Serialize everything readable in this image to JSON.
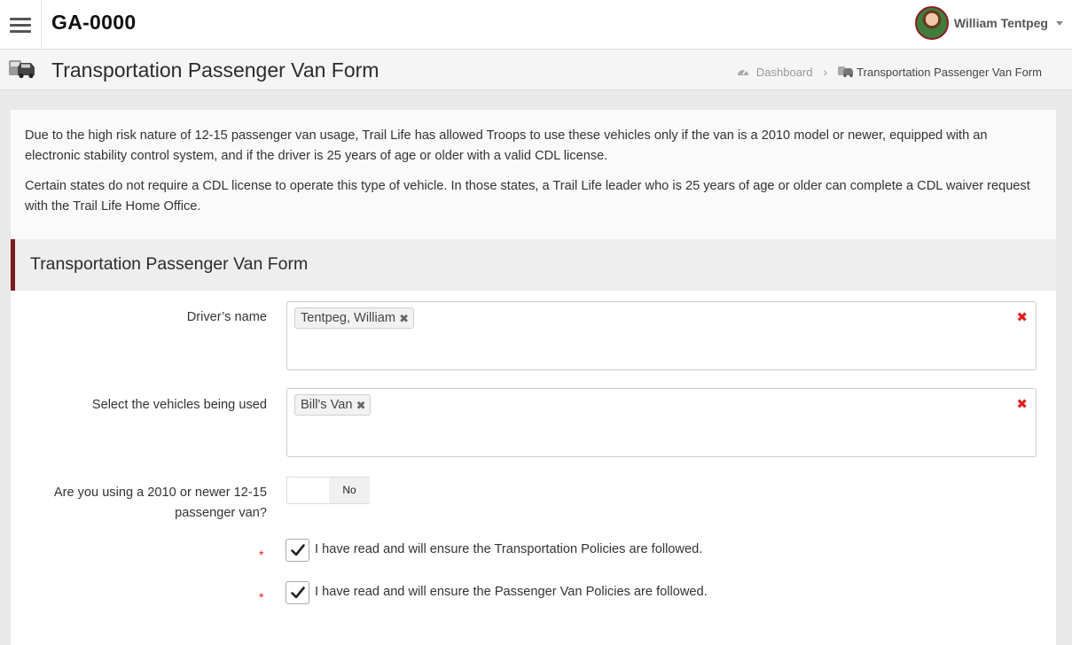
{
  "app": {
    "title": "GA-0000"
  },
  "user": {
    "name": "William Tentpeg"
  },
  "page": {
    "title": "Transportation Passenger Van Form"
  },
  "breadcrumb": {
    "home": "Dashboard",
    "current": "Transportation Passenger Van Form"
  },
  "intro": {
    "p1": "Due to the high risk nature of 12-15 passenger van usage, Trail Life has allowed Troops to use these vehicles only if the van is a 2010 model or newer, equipped with an electronic stability control system, and if the driver is 25 years of age or older with a valid CDL license.",
    "p2": "Certain states do not require a CDL license to operate this type of vehicle. In those states, a Trail Life leader who is 25 years of age or older can complete a CDL waiver request with the Trail Life Home Office."
  },
  "form": {
    "section_title": "Transportation Passenger Van Form",
    "driver": {
      "label": "Driver’s name",
      "tag": "Tentpeg, William"
    },
    "vehicles": {
      "label": "Select the vehicles being used",
      "tag": "Bill's Van"
    },
    "van_question": {
      "label_line1": "Are you using a 2010 or newer 12-15",
      "label_line2": "passenger van?",
      "toggle_value": "No"
    },
    "check1": {
      "label": "I have read and will ensure the Transportation Policies are followed.",
      "checked": true
    },
    "check2": {
      "label": "I have read and will ensure the Passenger Van Policies are followed.",
      "checked": true
    },
    "required_mark": "*",
    "remove_glyph": "✖",
    "clear_glyph": "✖"
  },
  "colors": {
    "accent": "#7a1a22",
    "required": "#e02020"
  }
}
